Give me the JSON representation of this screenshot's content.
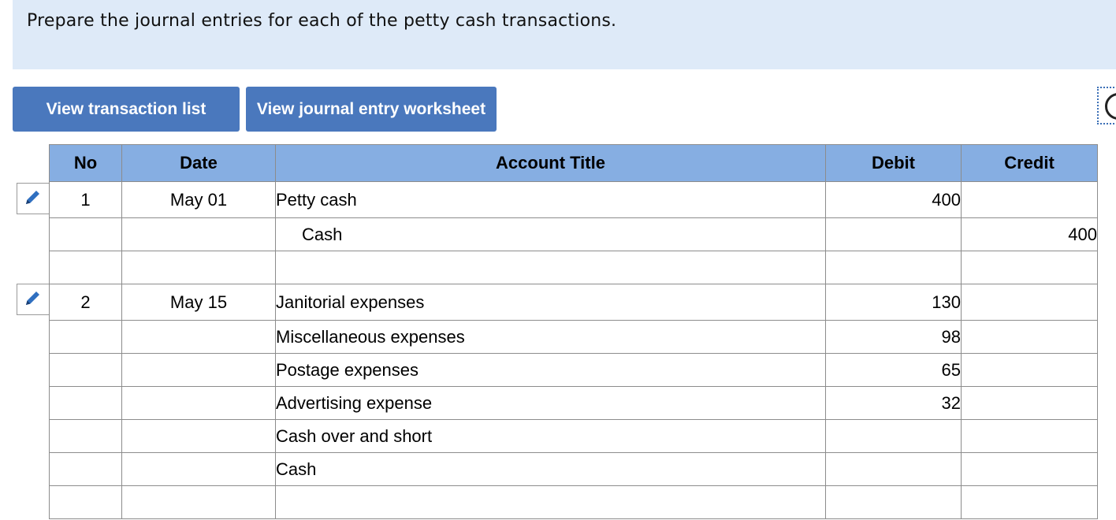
{
  "instructions": "Prepare the journal entries for each of the petty cash transactions.",
  "buttons": {
    "transaction_list": "View transaction list",
    "journal_worksheet": "View journal entry worksheet"
  },
  "table": {
    "headers": [
      "No",
      "Date",
      "Account Title",
      "Debit",
      "Credit"
    ],
    "rows": [
      {
        "no": "1",
        "date": "May 01",
        "account": "Petty cash",
        "debit": "400",
        "credit": ""
      },
      {
        "no": "",
        "date": "",
        "account": "Cash",
        "debit": "",
        "credit": "400"
      },
      {
        "no": "",
        "date": "",
        "account": "",
        "debit": "",
        "credit": ""
      },
      {
        "no": "2",
        "date": "May 15",
        "account": "Janitorial expenses",
        "debit": "130",
        "credit": ""
      },
      {
        "no": "",
        "date": "",
        "account": "Miscellaneous expenses",
        "debit": "98",
        "credit": ""
      },
      {
        "no": "",
        "date": "",
        "account": "Postage expenses",
        "debit": "65",
        "credit": ""
      },
      {
        "no": "",
        "date": "",
        "account": "Advertising expense",
        "debit": "32",
        "credit": ""
      },
      {
        "no": "",
        "date": "",
        "account": "Cash over and short",
        "debit": "",
        "credit": ""
      },
      {
        "no": "",
        "date": "",
        "account": "Cash",
        "debit": "",
        "credit": ""
      },
      {
        "no": "",
        "date": "",
        "account": "",
        "debit": "",
        "credit": ""
      }
    ]
  },
  "icons": {
    "edit": "pencil-icon",
    "corner": "circle-icon"
  },
  "colors": {
    "button_bg": "#4a78bd",
    "header_bg": "#86aee2",
    "instructions_bg": "#deeaf8",
    "pencil": "#2f6fc0"
  }
}
